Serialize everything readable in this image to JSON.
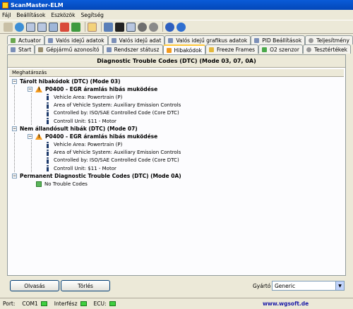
{
  "window": {
    "title": "ScanMaster-ELM"
  },
  "menu": [
    "Fájl",
    "Beállítások",
    "Eszközök",
    "Segítség"
  ],
  "toolbar_icons": [
    "wrench-icon",
    "globe-icon",
    "grid-icon",
    "grid-icon",
    "chart-icon",
    "flag-icon",
    "money-icon",
    "document-icon",
    "monitor-icon",
    "monitor-icon",
    "grid-icon",
    "gauge-icon",
    "stop-icon",
    "info-icon",
    "power-icon"
  ],
  "tabs_row1": [
    {
      "label": "Actuator",
      "icon_color": "#6aa84f"
    },
    {
      "label": "Valós idejű adatok",
      "icon_color": "#7b8fb8"
    },
    {
      "label": "Valós idejű adat",
      "icon_color": "#7b8fb8"
    },
    {
      "label": "Valós idejű grafikus adatok",
      "icon_color": "#7b8fb8"
    },
    {
      "label": "PID Beállítások",
      "icon_color": "#7b8fb8"
    },
    {
      "label": "Teljesítmény",
      "icon_color": "#999999"
    }
  ],
  "tabs_row2": [
    {
      "label": "Start",
      "icon_color": "#7b8fb8"
    },
    {
      "label": "Gépjármű azonosító",
      "icon_color": "#9a8f6f"
    },
    {
      "label": "Rendszer státusz",
      "icon_color": "#7b8fb8"
    },
    {
      "label": "Hibakódok",
      "icon_color": "#f39a1e",
      "active": true
    },
    {
      "label": "Freeze Frames",
      "icon_color": "#e3b83b"
    },
    {
      "label": "O2 szenzor",
      "icon_color": "#4aa84a"
    },
    {
      "label": "Tesztértékek",
      "icon_color": "#999999"
    }
  ],
  "panel": {
    "title": "Diagnostic Trouble Codes (DTC) (Mode 03, 07, 0A)",
    "column_header": "Meghatározás"
  },
  "tree": {
    "stored": {
      "label": "Tárolt hibakódok (DTC) (Mode 03)",
      "code": "P0400 - EGR áramlás hibás muködése",
      "details": [
        "Vehicle Area: Powertrain (P)",
        "Area of Vehicle System: Auxiliary Emission Controls",
        "Controlled by: ISO/SAE Controlled Code (Core DTC)",
        "Controll Unit: $11 - Motor"
      ]
    },
    "pending": {
      "label": "Nem állandósult hibák (DTC) (Mode 07)",
      "code": "P0400 - EGR áramlás hibás muködése",
      "details": [
        "Vehicle Area: Powertrain (P)",
        "Area of Vehicle System: Auxiliary Emission Controls",
        "Controlled by: ISO/SAE Controlled Code (Core DTC)",
        "Controll Unit: $11 - Motor"
      ]
    },
    "permanent": {
      "label": "Permanent Diagnostic Trouble Codes (DTC) (Mode 0A)",
      "none": "No Trouble Codes"
    }
  },
  "buttons": {
    "read": "Olvasás",
    "clear": "Törlés"
  },
  "manufacturer": {
    "label": "Gyártó",
    "value": "Generic"
  },
  "status": {
    "port_label": "Port:",
    "port_value": "COM1",
    "interface_label": "Interfész",
    "ecu_label": "ECU:",
    "link": "www.wgsoft.de"
  }
}
